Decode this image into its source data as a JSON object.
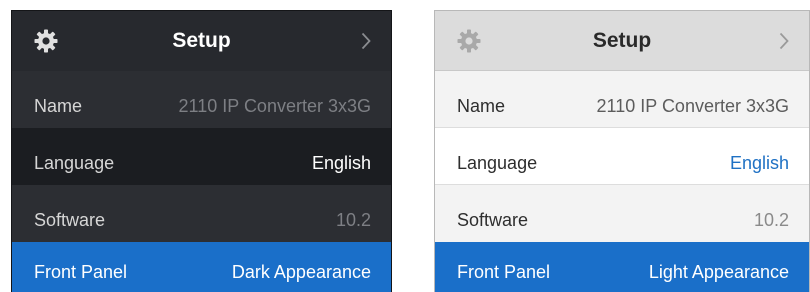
{
  "panels": {
    "dark": {
      "header": {
        "title": "Setup",
        "icon": "gear-icon",
        "next_icon": "chevron-right-icon"
      },
      "rows": [
        {
          "label": "Name",
          "value": "2110 IP Converter 3x3G"
        },
        {
          "label": "Language",
          "value": "English"
        },
        {
          "label": "Software",
          "value": "10.2"
        },
        {
          "label": "Front Panel",
          "value": "Dark Appearance"
        }
      ]
    },
    "light": {
      "header": {
        "title": "Setup",
        "icon": "gear-icon",
        "next_icon": "chevron-right-icon"
      },
      "rows": [
        {
          "label": "Name",
          "value": "2110 IP Converter 3x3G"
        },
        {
          "label": "Language",
          "value": "English"
        },
        {
          "label": "Software",
          "value": "10.2"
        },
        {
          "label": "Front Panel",
          "value": "Light Appearance"
        }
      ]
    }
  },
  "colors": {
    "accent_blue": "#1a6fc9",
    "link_blue": "#1f71c4",
    "dark_header": "#27292e",
    "dark_body": "#1a1c20",
    "light_header": "#dcdcdc"
  }
}
